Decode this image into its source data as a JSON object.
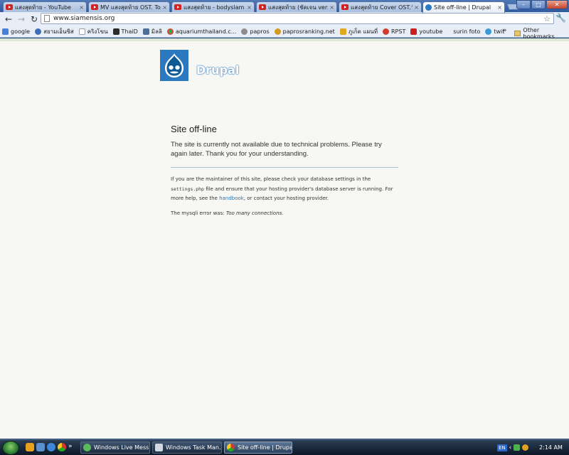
{
  "browser": {
    "tabs": [
      {
        "label": "แสงสุดท้าย - YouTube",
        "icon": "youtube-icon",
        "active": false
      },
      {
        "label": "MV แสงสุดท้าย OST. Top",
        "icon": "youtube-icon",
        "active": false
      },
      {
        "label": "แสงสุดท้าย - bodyslam - Y",
        "icon": "youtube-icon",
        "active": false
      },
      {
        "label": "แสงสุดท้าย (ชัดเจน version",
        "icon": "youtube-icon",
        "active": false
      },
      {
        "label": "แสงสุดท้าย Cover OST.วัย",
        "icon": "youtube-icon",
        "active": false
      },
      {
        "label": "Site off-line | Drupal",
        "icon": "drupal-icon",
        "active": true
      }
    ],
    "url": "www.siamensis.org",
    "bookmarks": [
      {
        "label": "google",
        "icon": "google-icon",
        "color": "#4a7fd8"
      },
      {
        "label": "สยามเอ็นซิส",
        "icon": "globe-icon",
        "color": "#3b6fb6"
      },
      {
        "label": "คริงโขน",
        "icon": "page-icon",
        "color": "#9aa0a6"
      },
      {
        "label": "ThaiD",
        "icon": "book-icon",
        "color": "#2b2b2b"
      },
      {
        "label": "มิลลิ",
        "icon": "person-icon",
        "color": "#4d6e9c"
      },
      {
        "label": "aquariumthailand.c...",
        "icon": "aquarium-icon",
        "color": "#d24a3a"
      },
      {
        "label": "papros",
        "icon": "flower-icon",
        "color": "#8c8c8c"
      },
      {
        "label": "paprosranking.net",
        "icon": "star-badge-icon",
        "color": "#d49a1f"
      },
      {
        "label": "ภูเก็ต แผนที่",
        "icon": "map-icon",
        "color": "#e0a820"
      },
      {
        "label": "RPST",
        "icon": "gear-icon",
        "color": "#d23a2f"
      },
      {
        "label": "youtube",
        "icon": "youtube-icon",
        "color": "#cc1f1f"
      },
      {
        "label": "surin foto",
        "icon": "blank-icon",
        "color": "#e8eef7"
      },
      {
        "label": "twit",
        "icon": "twitter-icon",
        "color": "#3a9ad9"
      }
    ],
    "more_bookmarks": "»",
    "other_bookmarks": "Other bookmarks"
  },
  "page": {
    "site_name": "Drupal",
    "heading": "Site off-line",
    "message": "The site is currently not available due to technical problems. Please try again later. Thank you for your understanding.",
    "maintainer_a": "If you are the maintainer of this site, please check your database settings in the",
    "maintainer_file": "settings.php",
    "maintainer_b": "file and ensure that your hosting provider's database server is running. For more help, see the",
    "handbook_link": "handbook",
    "maintainer_c": ", or contact your hosting provider.",
    "error_prefix": "The mysqli error was:",
    "error_text": "Too many connections."
  },
  "taskbar": {
    "tasks": [
      {
        "label": "Windows Live Mess...",
        "icon": "messenger-icon",
        "active": false
      },
      {
        "label": "Windows Task Man...",
        "icon": "task-manager-icon",
        "active": false
      },
      {
        "label": "Site off-line | Drupa...",
        "icon": "chrome-icon",
        "active": true
      }
    ],
    "language": "EN",
    "clock": "2:14 AM"
  },
  "colors": {
    "drupal_blue": "#2c79c0",
    "link": "#2973b3",
    "page_bg": "#f7f8f4",
    "divider": "#9fc0d8"
  }
}
